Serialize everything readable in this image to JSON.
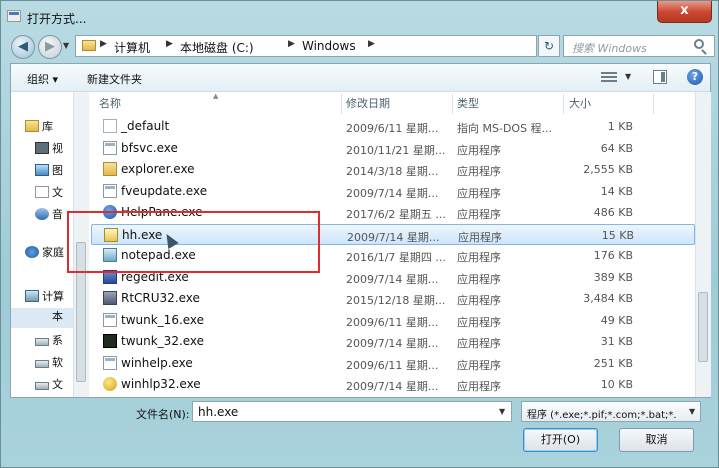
{
  "window": {
    "title": "打开方式...",
    "close_label": "x"
  },
  "address": {
    "back_icon": "back-arrow-icon",
    "forward_icon": "forward-arrow-icon",
    "crumbs": [
      "计算机",
      "本地磁盘 (C:)",
      "Windows"
    ],
    "search_placeholder": "搜索 Windows"
  },
  "toolbar": {
    "organize": "组织 ▾",
    "new_folder": "新建文件夹",
    "help": "?"
  },
  "nav": {
    "items": [
      {
        "label": "库"
      },
      {
        "label": "视"
      },
      {
        "label": "图"
      },
      {
        "label": "文"
      },
      {
        "label": "音"
      },
      {
        "label": "家庭"
      },
      {
        "label": "计算"
      },
      {
        "label": "本"
      },
      {
        "label": "系"
      },
      {
        "label": "软"
      },
      {
        "label": "文"
      }
    ]
  },
  "columns": {
    "name": "名称",
    "date": "修改日期",
    "type": "类型",
    "size": "大小"
  },
  "files": [
    {
      "name": "_default",
      "date": "2009/6/11 星期...",
      "type": "指向 MS-DOS 程...",
      "size": "1 KB",
      "icon": "doc"
    },
    {
      "name": "bfsvc.exe",
      "date": "2010/11/21 星期...",
      "type": "应用程序",
      "size": "64 KB",
      "icon": "exe"
    },
    {
      "name": "explorer.exe",
      "date": "2014/3/18 星期...",
      "type": "应用程序",
      "size": "2,555 KB",
      "icon": "folder"
    },
    {
      "name": "fveupdate.exe",
      "date": "2009/7/14 星期...",
      "type": "应用程序",
      "size": "14 KB",
      "icon": "exe"
    },
    {
      "name": "HelpPane.exe",
      "date": "2017/6/2 星期五 ...",
      "type": "应用程序",
      "size": "486 KB",
      "icon": "help"
    },
    {
      "name": "hh.exe",
      "date": "2009/7/14 星期...",
      "type": "应用程序",
      "size": "15 KB",
      "icon": "hh",
      "selected": true
    },
    {
      "name": "notepad.exe",
      "date": "2016/1/7 星期四 ...",
      "type": "应用程序",
      "size": "176 KB",
      "icon": "note"
    },
    {
      "name": "regedit.exe",
      "date": "2009/7/14 星期...",
      "type": "应用程序",
      "size": "389 KB",
      "icon": "reg"
    },
    {
      "name": "RtCRU32.exe",
      "date": "2015/12/18 星期...",
      "type": "应用程序",
      "size": "3,484 KB",
      "icon": "rt"
    },
    {
      "name": "twunk_16.exe",
      "date": "2009/6/11 星期...",
      "type": "应用程序",
      "size": "49 KB",
      "icon": "exe"
    },
    {
      "name": "twunk_32.exe",
      "date": "2009/7/14 星期...",
      "type": "应用程序",
      "size": "31 KB",
      "icon": "tw"
    },
    {
      "name": "winhelp.exe",
      "date": "2009/6/11 星期...",
      "type": "应用程序",
      "size": "251 KB",
      "icon": "exe"
    },
    {
      "name": "winhlp32.exe",
      "date": "2009/7/14 星期...",
      "type": "应用程序",
      "size": "10 KB",
      "icon": "wh"
    }
  ],
  "bottom": {
    "filename_label": "文件名(N):",
    "filename_value": "hh.exe",
    "filter_value": "程序 (*.exe;*.pif;*.com;*.bat;*.",
    "open_label": "打开(O)",
    "cancel_label": "取消"
  }
}
